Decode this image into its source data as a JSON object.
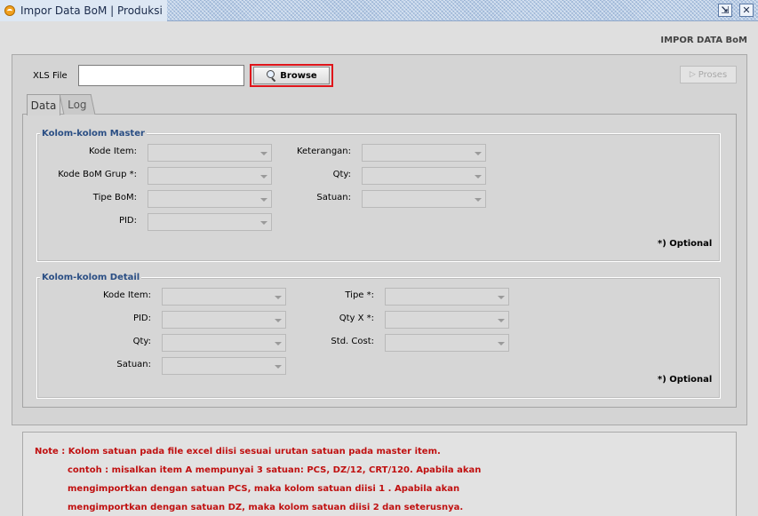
{
  "window": {
    "title": "Impor Data BoM | Produksi",
    "restore_glyph": "⇲",
    "close_glyph": "✕"
  },
  "header": {
    "section_title": "IMPOR DATA BoM"
  },
  "file": {
    "label": "XLS File",
    "value": "",
    "browse_label": "Browse",
    "proses_label": "Proses"
  },
  "tabs": [
    {
      "label": "Data",
      "active": true
    },
    {
      "label": "Log",
      "active": false
    }
  ],
  "master": {
    "title": "Kolom-kolom Master",
    "fields": [
      {
        "label": "Kode Item:",
        "value": ""
      },
      {
        "label": "Kode BoM Grup *:",
        "value": ""
      },
      {
        "label": "Tipe BoM:",
        "value": ""
      },
      {
        "label": "PID:",
        "value": ""
      },
      {
        "label": "Keterangan:",
        "value": ""
      },
      {
        "label": "Qty:",
        "value": ""
      },
      {
        "label": "Satuan:",
        "value": ""
      }
    ],
    "optional_note": "*) Optional"
  },
  "detail": {
    "title": "Kolom-kolom Detail",
    "fields": [
      {
        "label": "Kode Item:",
        "value": ""
      },
      {
        "label": "PID:",
        "value": ""
      },
      {
        "label": "Qty:",
        "value": ""
      },
      {
        "label": "Satuan:",
        "value": ""
      },
      {
        "label": "Tipe *:",
        "value": ""
      },
      {
        "label": "Qty X *:",
        "value": ""
      },
      {
        "label": "Std. Cost:",
        "value": ""
      }
    ],
    "optional_note": "*) Optional"
  },
  "note": {
    "lines": [
      "Note :  Kolom satuan pada file excel diisi sesuai urutan satuan pada master item.",
      "contoh : misalkan item A mempunyai 3 satuan: PCS, DZ/12, CRT/120. Apabila akan",
      "mengimportkan dengan satuan PCS,  maka kolom satuan diisi 1 . Apabila akan",
      "mengimportkan dengan satuan DZ,  maka kolom satuan diisi 2 dan seterusnya."
    ]
  },
  "colors": {
    "title_text": "#1a2a4a",
    "group_title": "#2a4e84",
    "note_text": "#c01010",
    "highlight_frame": "#e0141a"
  },
  "icons": {
    "app": "app-logo-icon",
    "browse": "magnifier-icon",
    "proses": "play-arrow-icon",
    "combo": "chevron-down-icon"
  }
}
